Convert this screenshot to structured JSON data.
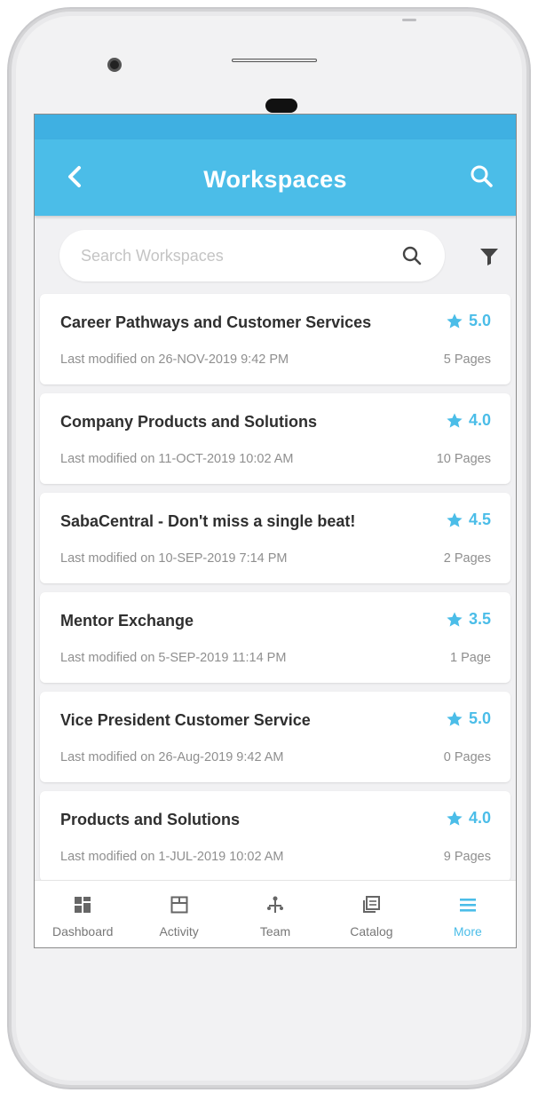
{
  "header": {
    "title": "Workspaces"
  },
  "search": {
    "placeholder": "Search Workspaces",
    "value": ""
  },
  "workspaces": [
    {
      "title": "Career Pathways and Customer Services",
      "meta": "Last modified on 26-NOV-2019 9:42 PM",
      "rating": "5.0",
      "pages": "5 Pages"
    },
    {
      "title": "Company Products and Solutions",
      "meta": "Last modified on 11-OCT-2019 10:02 AM",
      "rating": "4.0",
      "pages": "10 Pages"
    },
    {
      "title": "SabaCentral - Don't miss a single beat!",
      "meta": "Last modified on 10-SEP-2019 7:14 PM",
      "rating": "4.5",
      "pages": "2 Pages"
    },
    {
      "title": "Mentor Exchange",
      "meta": "Last modified on 5-SEP-2019 11:14 PM",
      "rating": "3.5",
      "pages": "1 Page"
    },
    {
      "title": "Vice President Customer Service",
      "meta": "Last modified on 26-Aug-2019 9:42 AM",
      "rating": "5.0",
      "pages": "0 Pages"
    },
    {
      "title": "Products and Solutions",
      "meta": "Last modified on 1-JUL-2019 10:02 AM",
      "rating": "4.0",
      "pages": "9 Pages"
    }
  ],
  "tabs": [
    {
      "label": "Dashboard",
      "icon": "dashboard-icon",
      "active": false
    },
    {
      "label": "Activity",
      "icon": "activity-icon",
      "active": false
    },
    {
      "label": "Team",
      "icon": "team-icon",
      "active": false
    },
    {
      "label": "Catalog",
      "icon": "catalog-icon",
      "active": false
    },
    {
      "label": "More",
      "icon": "menu-icon",
      "active": true
    }
  ],
  "colors": {
    "accent": "#4bbde8",
    "statusbar": "#3fb0e2",
    "background": "#f1f1f3"
  }
}
